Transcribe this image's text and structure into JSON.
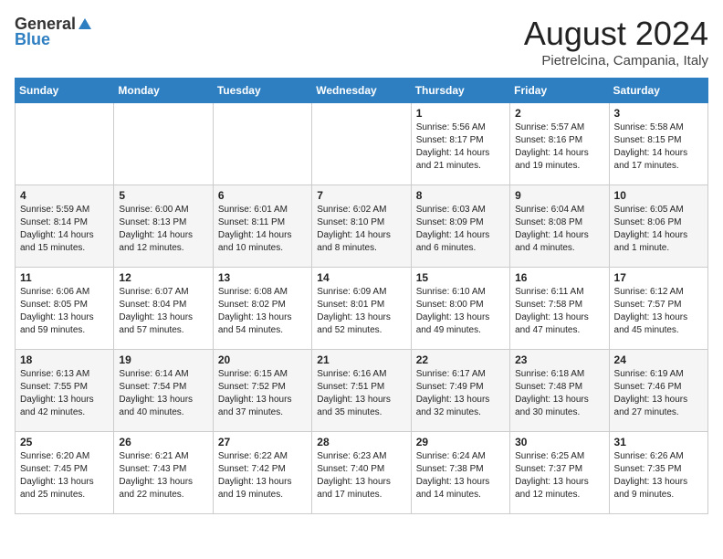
{
  "header": {
    "logo_general": "General",
    "logo_blue": "Blue",
    "month_year": "August 2024",
    "location": "Pietrelcina, Campania, Italy"
  },
  "days_of_week": [
    "Sunday",
    "Monday",
    "Tuesday",
    "Wednesday",
    "Thursday",
    "Friday",
    "Saturday"
  ],
  "weeks": [
    [
      {
        "day": "",
        "text": ""
      },
      {
        "day": "",
        "text": ""
      },
      {
        "day": "",
        "text": ""
      },
      {
        "day": "",
        "text": ""
      },
      {
        "day": "1",
        "text": "Sunrise: 5:56 AM\nSunset: 8:17 PM\nDaylight: 14 hours\nand 21 minutes."
      },
      {
        "day": "2",
        "text": "Sunrise: 5:57 AM\nSunset: 8:16 PM\nDaylight: 14 hours\nand 19 minutes."
      },
      {
        "day": "3",
        "text": "Sunrise: 5:58 AM\nSunset: 8:15 PM\nDaylight: 14 hours\nand 17 minutes."
      }
    ],
    [
      {
        "day": "4",
        "text": "Sunrise: 5:59 AM\nSunset: 8:14 PM\nDaylight: 14 hours\nand 15 minutes."
      },
      {
        "day": "5",
        "text": "Sunrise: 6:00 AM\nSunset: 8:13 PM\nDaylight: 14 hours\nand 12 minutes."
      },
      {
        "day": "6",
        "text": "Sunrise: 6:01 AM\nSunset: 8:11 PM\nDaylight: 14 hours\nand 10 minutes."
      },
      {
        "day": "7",
        "text": "Sunrise: 6:02 AM\nSunset: 8:10 PM\nDaylight: 14 hours\nand 8 minutes."
      },
      {
        "day": "8",
        "text": "Sunrise: 6:03 AM\nSunset: 8:09 PM\nDaylight: 14 hours\nand 6 minutes."
      },
      {
        "day": "9",
        "text": "Sunrise: 6:04 AM\nSunset: 8:08 PM\nDaylight: 14 hours\nand 4 minutes."
      },
      {
        "day": "10",
        "text": "Sunrise: 6:05 AM\nSunset: 8:06 PM\nDaylight: 14 hours\nand 1 minute."
      }
    ],
    [
      {
        "day": "11",
        "text": "Sunrise: 6:06 AM\nSunset: 8:05 PM\nDaylight: 13 hours\nand 59 minutes."
      },
      {
        "day": "12",
        "text": "Sunrise: 6:07 AM\nSunset: 8:04 PM\nDaylight: 13 hours\nand 57 minutes."
      },
      {
        "day": "13",
        "text": "Sunrise: 6:08 AM\nSunset: 8:02 PM\nDaylight: 13 hours\nand 54 minutes."
      },
      {
        "day": "14",
        "text": "Sunrise: 6:09 AM\nSunset: 8:01 PM\nDaylight: 13 hours\nand 52 minutes."
      },
      {
        "day": "15",
        "text": "Sunrise: 6:10 AM\nSunset: 8:00 PM\nDaylight: 13 hours\nand 49 minutes."
      },
      {
        "day": "16",
        "text": "Sunrise: 6:11 AM\nSunset: 7:58 PM\nDaylight: 13 hours\nand 47 minutes."
      },
      {
        "day": "17",
        "text": "Sunrise: 6:12 AM\nSunset: 7:57 PM\nDaylight: 13 hours\nand 45 minutes."
      }
    ],
    [
      {
        "day": "18",
        "text": "Sunrise: 6:13 AM\nSunset: 7:55 PM\nDaylight: 13 hours\nand 42 minutes."
      },
      {
        "day": "19",
        "text": "Sunrise: 6:14 AM\nSunset: 7:54 PM\nDaylight: 13 hours\nand 40 minutes."
      },
      {
        "day": "20",
        "text": "Sunrise: 6:15 AM\nSunset: 7:52 PM\nDaylight: 13 hours\nand 37 minutes."
      },
      {
        "day": "21",
        "text": "Sunrise: 6:16 AM\nSunset: 7:51 PM\nDaylight: 13 hours\nand 35 minutes."
      },
      {
        "day": "22",
        "text": "Sunrise: 6:17 AM\nSunset: 7:49 PM\nDaylight: 13 hours\nand 32 minutes."
      },
      {
        "day": "23",
        "text": "Sunrise: 6:18 AM\nSunset: 7:48 PM\nDaylight: 13 hours\nand 30 minutes."
      },
      {
        "day": "24",
        "text": "Sunrise: 6:19 AM\nSunset: 7:46 PM\nDaylight: 13 hours\nand 27 minutes."
      }
    ],
    [
      {
        "day": "25",
        "text": "Sunrise: 6:20 AM\nSunset: 7:45 PM\nDaylight: 13 hours\nand 25 minutes."
      },
      {
        "day": "26",
        "text": "Sunrise: 6:21 AM\nSunset: 7:43 PM\nDaylight: 13 hours\nand 22 minutes."
      },
      {
        "day": "27",
        "text": "Sunrise: 6:22 AM\nSunset: 7:42 PM\nDaylight: 13 hours\nand 19 minutes."
      },
      {
        "day": "28",
        "text": "Sunrise: 6:23 AM\nSunset: 7:40 PM\nDaylight: 13 hours\nand 17 minutes."
      },
      {
        "day": "29",
        "text": "Sunrise: 6:24 AM\nSunset: 7:38 PM\nDaylight: 13 hours\nand 14 minutes."
      },
      {
        "day": "30",
        "text": "Sunrise: 6:25 AM\nSunset: 7:37 PM\nDaylight: 13 hours\nand 12 minutes."
      },
      {
        "day": "31",
        "text": "Sunrise: 6:26 AM\nSunset: 7:35 PM\nDaylight: 13 hours\nand 9 minutes."
      }
    ]
  ]
}
